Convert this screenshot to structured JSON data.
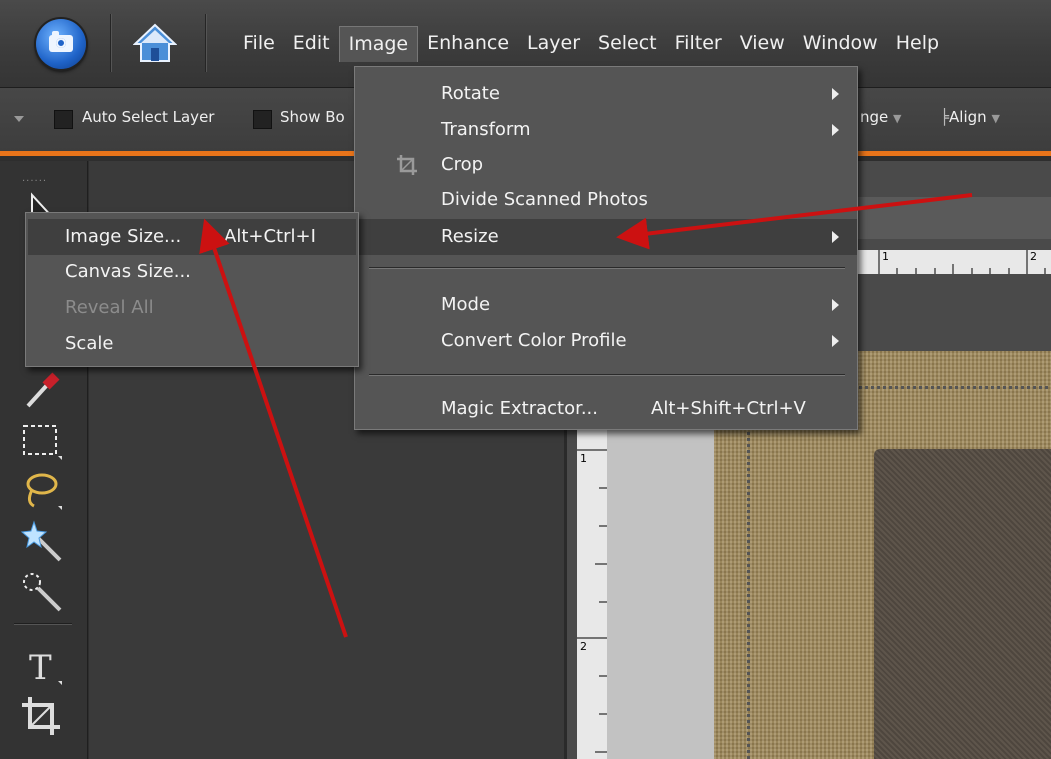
{
  "menubar": {
    "items": [
      "File",
      "Edit",
      "Image",
      "Enhance",
      "Layer",
      "Select",
      "Filter",
      "View",
      "Window",
      "Help"
    ],
    "active": "Image"
  },
  "options_bar": {
    "auto_select_layer": "Auto Select Layer",
    "show_bounding": "Show Bo",
    "arrange_partial": "nge",
    "align": "Align"
  },
  "image_menu": {
    "items": [
      {
        "label": "Rotate",
        "submenu": true
      },
      {
        "label": "Transform",
        "submenu": true
      },
      {
        "label": "Crop",
        "icon": "crop-icon"
      },
      {
        "label": "Divide Scanned Photos"
      },
      {
        "label": "Resize",
        "submenu": true,
        "highlighted": true
      },
      {
        "label": "Mode",
        "submenu": true
      },
      {
        "label": "Convert Color Profile",
        "submenu": true
      },
      {
        "label": "Magic Extractor...",
        "shortcut": "Alt+Shift+Ctrl+V"
      }
    ]
  },
  "resize_submenu": {
    "items": [
      {
        "label": "Image Size...",
        "shortcut": "Alt+Ctrl+I",
        "highlighted": true
      },
      {
        "label": "Canvas Size..."
      },
      {
        "label": "Reveal All",
        "disabled": true
      },
      {
        "label": "Scale"
      }
    ]
  },
  "rulers": {
    "horizontal": [
      "1",
      "2"
    ],
    "vertical": [
      "1",
      "2"
    ]
  },
  "colors": {
    "accent_orange": "#e8741a",
    "annotation_arrow": "#cc1111",
    "menu_bg": "#555555",
    "highlight_bg": "#3f3f3f"
  }
}
